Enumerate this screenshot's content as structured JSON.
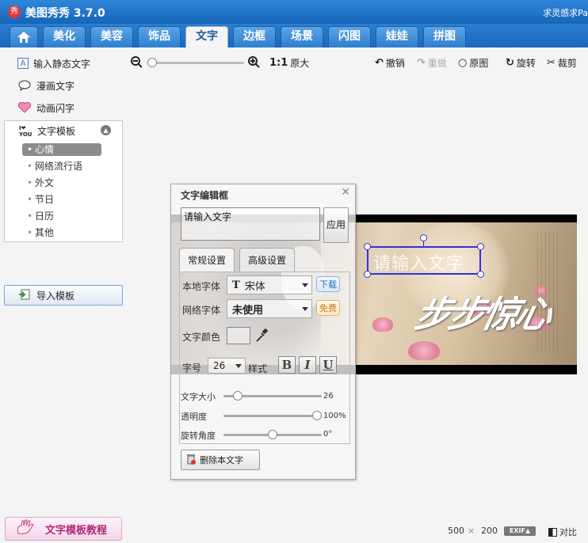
{
  "window": {
    "logo_glyph": "秀",
    "title": "美图秀秀 3.7.0",
    "right_text": "求灵感求Pa"
  },
  "tabs": [
    "美化",
    "美容",
    "饰品",
    "文字",
    "边框",
    "场景",
    "闪图",
    "娃娃",
    "拼图"
  ],
  "active_tab": "文字",
  "sidebar": {
    "items": [
      {
        "label": "输入静态文字",
        "icon": "text-a-icon"
      },
      {
        "label": "漫画文字",
        "icon": "speech-bubble-icon"
      },
      {
        "label": "动画闪字",
        "icon": "flash-text-icon"
      }
    ],
    "template_header": "文字模板",
    "template_icon_text": "I❤YOU",
    "categories": [
      "心情",
      "网络流行语",
      "外文",
      "节日",
      "日历",
      "其他"
    ],
    "selected_category": "心情",
    "import_label": "导入模板",
    "tutorial_label": "文字模板教程"
  },
  "toolbar": {
    "zoom_ratio_label": "1:1",
    "original_size_label": "原大",
    "undo_label": "撤销",
    "redo_label": "重做",
    "original_label": "原图",
    "rotate_label": "旋转",
    "crop_label": "裁剪"
  },
  "canvas": {
    "text_box_value": "请输入文字",
    "calligraphy_text": "步步惊心"
  },
  "editor": {
    "title": "文字编辑框",
    "input_value": "请输入文字",
    "apply_label": "应用",
    "tab_basic": "常规设置",
    "tab_advanced": "高级设置",
    "local_font_label": "本地字体",
    "local_font_value": "宋体",
    "download_label": "下载",
    "web_font_label": "网络字体",
    "web_font_value": "未使用",
    "free_label": "免费",
    "color_label": "文字颜色",
    "size_label": "字号",
    "size_value": "26",
    "style_label": "样式",
    "bold_label": "B",
    "italic_label": "I",
    "underline_label": "U",
    "text_size_label": "文字大小",
    "text_size_value": "26",
    "opacity_label": "透明度",
    "opacity_value": "100%",
    "rotation_label": "旋转角度",
    "rotation_value": "0°",
    "delete_label": "删除本文字"
  },
  "status": {
    "width": "500",
    "times": "×",
    "height": "200",
    "exif_label": "EXIF▲",
    "compare_label": "对比"
  },
  "colors": {
    "title_bar": "#1f72c6",
    "selection": "#2b33d9",
    "tutorial_text": "#b0297a"
  }
}
